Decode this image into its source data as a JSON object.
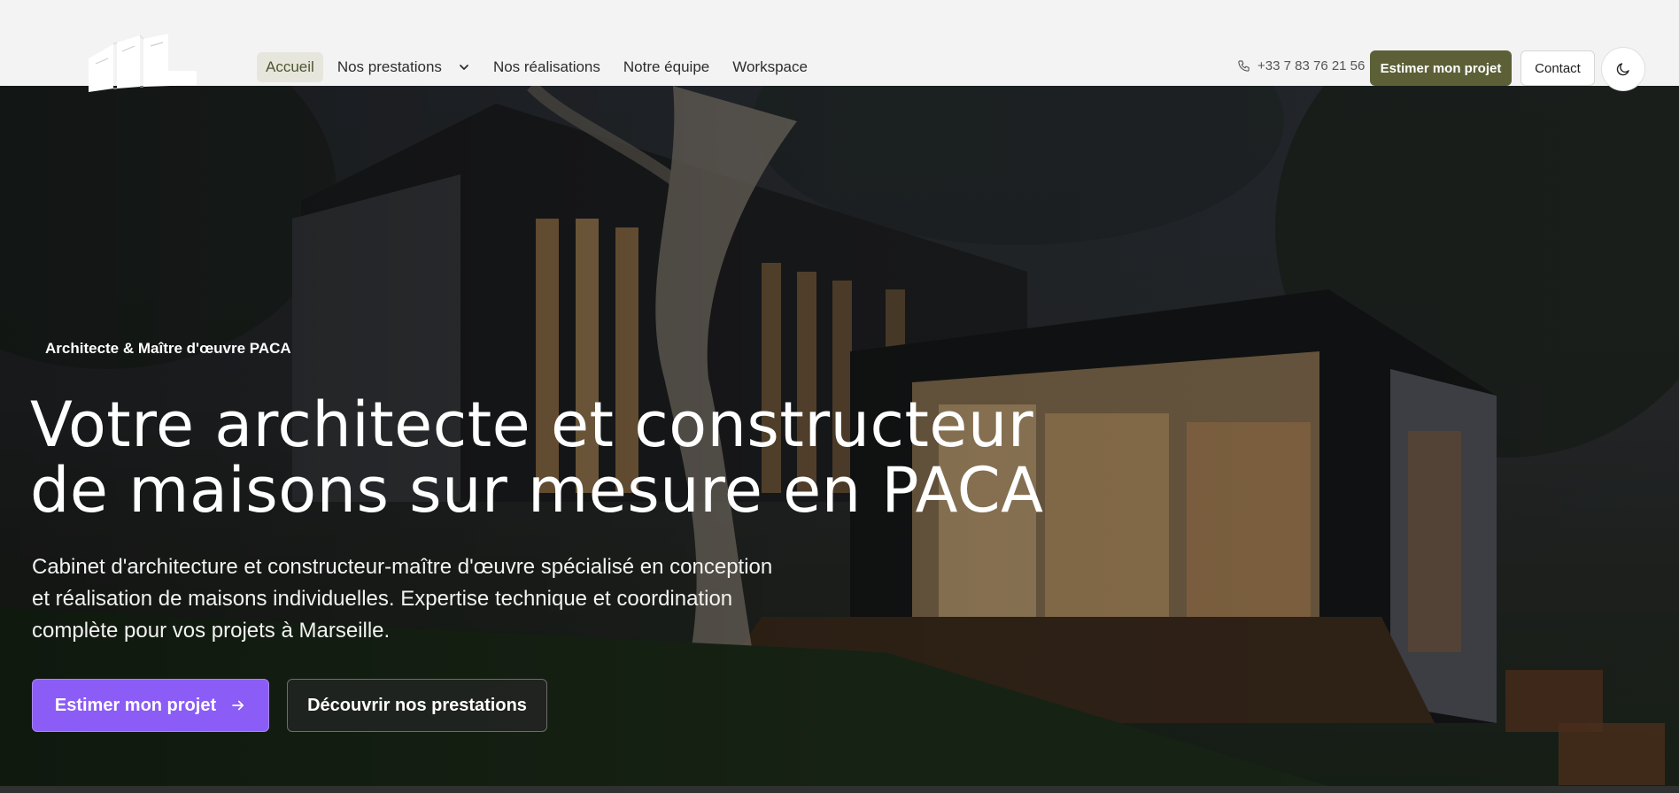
{
  "header": {
    "logo_icon": "house-outline-logo",
    "nav": [
      {
        "label": "Accueil",
        "active": true
      },
      {
        "label": "Nos prestations",
        "has_dropdown": true
      },
      {
        "label": "Nos réalisations"
      },
      {
        "label": "Notre équipe"
      },
      {
        "label": "Workspace"
      }
    ],
    "phone": "+33 7 83 76 21 56",
    "phone_icon": "phone-icon",
    "estimate_button": "Estimer mon projet",
    "contact_button": "Contact",
    "theme_toggle_icon": "moon-icon"
  },
  "hero": {
    "eyebrow": "Architecte & Maître d'œuvre PACA",
    "title_line1": "Votre architecte et constructeur",
    "title_line2": "de maisons sur mesure en PACA",
    "subtitle": "Cabinet d'architecture et constructeur-maître d'œuvre spécialisé en conception et réalisation de maisons individuelles. Expertise technique et coordination complète pour vos projets à Marseille.",
    "primary_button": "Estimer mon projet",
    "primary_button_icon": "arrow-right-icon",
    "secondary_button": "Découvrir nos prestations"
  },
  "colors": {
    "accent_olive": "#5d6037",
    "accent_purple": "#8b5cf6",
    "header_bg": "#f3f3f4"
  }
}
